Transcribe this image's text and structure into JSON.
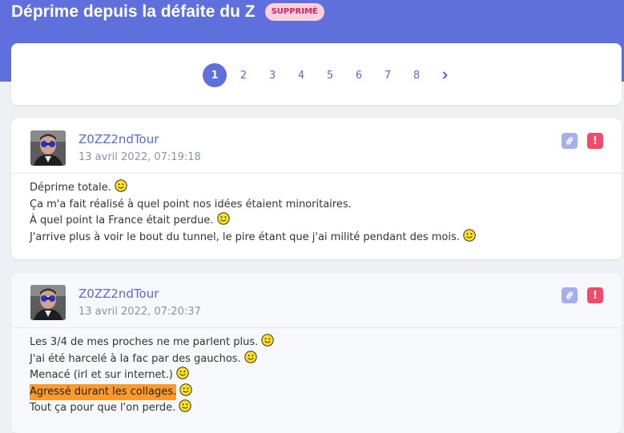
{
  "header": {
    "title": "Déprime depuis la défaite du Z",
    "badge": "SUPPRIMÉ",
    "brand_color": "#5f6fdc"
  },
  "pagination": {
    "pages": [
      "1",
      "2",
      "3",
      "4",
      "5",
      "6",
      "7",
      "8"
    ],
    "current": "1",
    "next_icon": "chevron-right-icon"
  },
  "posts": [
    {
      "author": "Z0ZZ2ndTour",
      "date": "13 avril 2022, 07:19:18",
      "lines": [
        {
          "text": "Déprime totale.",
          "smiley": true
        },
        {
          "text": "Ça m'a fait réalisé à quel point nos idées étaient minoritaires.",
          "smiley": false
        },
        {
          "text": "À quel point la France était perdue.",
          "smiley": true
        },
        {
          "text": "J'arrive plus à voir le bout du tunnel, le pire étant que j'ai milité pendant des mois.",
          "smiley": true
        }
      ]
    },
    {
      "author": "Z0ZZ2ndTour",
      "date": "13 avril 2022, 07:20:37",
      "lines": [
        {
          "text": "Les 3/4 de mes proches ne me parlent plus.",
          "smiley": true
        },
        {
          "text": "J'ai été harcelé à la fac par des gauchos.",
          "smiley": true
        },
        {
          "text": "Menacé (irl et sur internet.)",
          "smiley": true
        },
        {
          "text": "Agressé durant les collages.",
          "smiley": true,
          "highlight": true
        },
        {
          "text": "Tout ça pour que l'on perde.",
          "smiley": true
        }
      ]
    }
  ]
}
